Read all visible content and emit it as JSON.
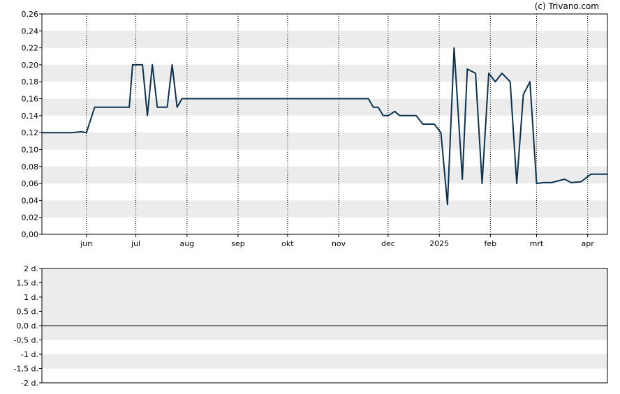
{
  "credit": "(c) Trivano.com",
  "colors": {
    "line": "#0b3350",
    "band": "#ececec",
    "axis": "#000000",
    "vgrid": "#000000"
  },
  "chart_data": [
    {
      "type": "line",
      "grid": "horizontal alternating bands, dotted vertical month lines",
      "ylim": [
        0,
        0.26
      ],
      "y_ticks": [
        0,
        0.02,
        0.04,
        0.06,
        0.08,
        0.1,
        0.12,
        0.14,
        0.16,
        0.18,
        0.2,
        0.22,
        0.24,
        0.26
      ],
      "y_tick_labels": [
        "0,00",
        "0,02",
        "0,04",
        "0,06",
        "0,08",
        "0,10",
        "0,12",
        "0,14",
        "0,16",
        "0,18",
        "0,20",
        "0,22",
        "0,24",
        "0,26"
      ],
      "x_range": [
        "2024-05-05",
        "2025-04-13"
      ],
      "x_ticks": [
        {
          "label": "jun",
          "date": "2024-06-01"
        },
        {
          "label": "jul",
          "date": "2024-07-01"
        },
        {
          "label": "aug",
          "date": "2024-08-01"
        },
        {
          "label": "sep",
          "date": "2024-09-01"
        },
        {
          "label": "okt",
          "date": "2024-10-01"
        },
        {
          "label": "nov",
          "date": "2024-11-01"
        },
        {
          "label": "dec",
          "date": "2024-12-01"
        },
        {
          "label": "2025",
          "date": "2025-01-01"
        },
        {
          "label": "feb",
          "date": "2025-02-01"
        },
        {
          "label": "mrt",
          "date": "2025-03-01"
        },
        {
          "label": "apr",
          "date": "2025-04-01"
        }
      ],
      "series": [
        {
          "points": [
            [
              "2024-05-05",
              0.12
            ],
            [
              "2024-05-23",
              0.12
            ],
            [
              "2024-05-29",
              0.121
            ],
            [
              "2024-06-01",
              0.12
            ],
            [
              "2024-06-06",
              0.15
            ],
            [
              "2024-06-24",
              0.15
            ],
            [
              "2024-06-27",
              0.15
            ],
            [
              "2024-06-29",
              0.2
            ],
            [
              "2024-07-05",
              0.2
            ],
            [
              "2024-07-08",
              0.14
            ],
            [
              "2024-07-11",
              0.2
            ],
            [
              "2024-07-14",
              0.15
            ],
            [
              "2024-07-20",
              0.15
            ],
            [
              "2024-07-23",
              0.2
            ],
            [
              "2024-07-26",
              0.15
            ],
            [
              "2024-07-29",
              0.16
            ],
            [
              "2024-11-19",
              0.16
            ],
            [
              "2024-11-22",
              0.15
            ],
            [
              "2024-11-25",
              0.15
            ],
            [
              "2024-11-28",
              0.14
            ],
            [
              "2024-12-01",
              0.14
            ],
            [
              "2024-12-05",
              0.145
            ],
            [
              "2024-12-08",
              0.14
            ],
            [
              "2024-12-18",
              0.14
            ],
            [
              "2024-12-22",
              0.13
            ],
            [
              "2024-12-29",
              0.13
            ],
            [
              "2025-01-02",
              0.12
            ],
            [
              "2025-01-06",
              0.035
            ],
            [
              "2025-01-10",
              0.22
            ],
            [
              "2025-01-15",
              0.065
            ],
            [
              "2025-01-18",
              0.195
            ],
            [
              "2025-01-23",
              0.19
            ],
            [
              "2025-01-27",
              0.06
            ],
            [
              "2025-01-31",
              0.19
            ],
            [
              "2025-02-04",
              0.18
            ],
            [
              "2025-02-08",
              0.19
            ],
            [
              "2025-02-13",
              0.18
            ],
            [
              "2025-02-17",
              0.06
            ],
            [
              "2025-02-21",
              0.165
            ],
            [
              "2025-02-25",
              0.18
            ],
            [
              "2025-03-01",
              0.06
            ],
            [
              "2025-03-05",
              0.061
            ],
            [
              "2025-03-10",
              0.061
            ],
            [
              "2025-03-18",
              0.065
            ],
            [
              "2025-03-22",
              0.061
            ],
            [
              "2025-03-28",
              0.062
            ],
            [
              "2025-04-03",
              0.071
            ],
            [
              "2025-04-13",
              0.071
            ]
          ]
        }
      ]
    },
    {
      "type": "line",
      "grid": "horizontal alternating bands",
      "ylim": [
        -2,
        2
      ],
      "y_ticks": [
        -2,
        -1.5,
        -1,
        -0.5,
        0,
        0.5,
        1,
        1.5,
        2
      ],
      "y_tick_labels": [
        "-2 d.",
        "-1,5 d.",
        "-1 d.",
        "-0,5 d.",
        "0,0 d.",
        "0,5 d.",
        "1 d.",
        "1,5 d.",
        "2 d."
      ],
      "series": [
        {
          "points": []
        }
      ]
    }
  ]
}
